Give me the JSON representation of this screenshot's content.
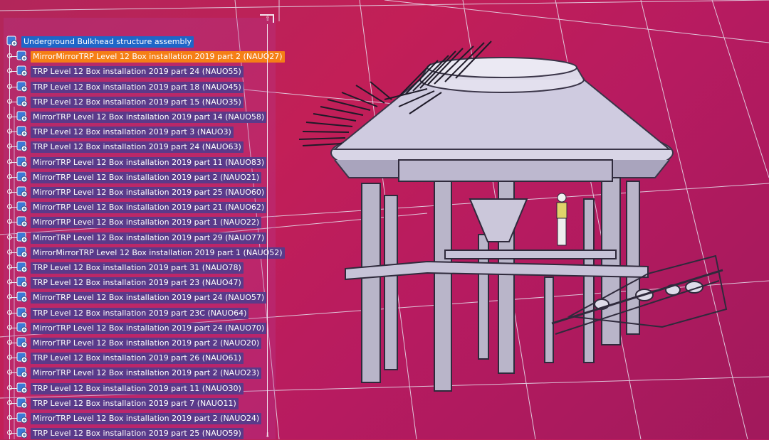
{
  "tree": {
    "root_label": "Underground Bulkhead structure assembly",
    "items": [
      {
        "label": "MirrorMirrorTRP Level 12 Box installation 2019 part 2 (NAUO27)",
        "highlight": true
      },
      {
        "label": "TRP Level 12 Box installation 2019 part 24 (NAUO55)"
      },
      {
        "label": "TRP Level 12 Box installation 2019 part 18 (NAUO45)"
      },
      {
        "label": "TRP Level 12 Box installation 2019 part 15 (NAUO35)"
      },
      {
        "label": "MirrorTRP Level 12 Box installation 2019 part 14 (NAUO58)"
      },
      {
        "label": "TRP Level 12 Box installation 2019 part 3 (NAUO3)"
      },
      {
        "label": "TRP Level 12 Box installation 2019 part 24 (NAUO63)"
      },
      {
        "label": "MirrorTRP Level 12 Box installation 2019 part 11 (NAUO83)"
      },
      {
        "label": "MirrorTRP Level 12 Box installation 2019 part 2 (NAUO21)"
      },
      {
        "label": "MirrorTRP Level 12 Box installation 2019 part 25 (NAUO60)"
      },
      {
        "label": "MirrorTRP Level 12 Box installation 2019 part 21 (NAUO62)"
      },
      {
        "label": "MirrorTRP Level 12 Box installation 2019 part 1 (NAUO22)"
      },
      {
        "label": "MirrorTRP Level 12 Box installation 2019 part 29 (NAUO77)"
      },
      {
        "label": "MirrorMirrorTRP Level 12 Box installation 2019 part 1 (NAUO52)"
      },
      {
        "label": "TRP Level 12 Box installation 2019 part 31 (NAUO78)"
      },
      {
        "label": "TRP Level 12 Box installation 2019 part 23 (NAUO47)"
      },
      {
        "label": "MirrorTRP Level 12 Box installation 2019 part 24 (NAUO57)"
      },
      {
        "label": "TRP Level 12 Box installation 2019 part 23C (NAUO64)"
      },
      {
        "label": "MirrorTRP Level 12 Box installation 2019 part 24 (NAUO70)"
      },
      {
        "label": "MirrorTRP Level 12 Box installation 2019 part 2 (NAUO20)"
      },
      {
        "label": "TRP Level 12 Box installation 2019 part 26 (NAUO61)"
      },
      {
        "label": "MirrorTRP Level 12 Box installation 2019 part 2 (NAUO23)"
      },
      {
        "label": "TRP Level 12 Box installation 2019 part 11 (NAUO30)"
      },
      {
        "label": "TRP Level 12 Box installation 2019 part 7 (NAUO11)"
      },
      {
        "label": "MirrorTRP Level 12 Box installation 2019 part 2 (NAUO24)"
      },
      {
        "label": "TRP Level 12 Box installation 2019 part 25 (NAUO59)"
      }
    ]
  },
  "colors": {
    "background": "#c21f57",
    "root_selection": "#1e66c8",
    "highlight": "#f57f16",
    "label_bg": "#5a3a8a"
  },
  "icons": {
    "node_icon": "assembly-product-icon",
    "expander": "expand-node-icon"
  }
}
